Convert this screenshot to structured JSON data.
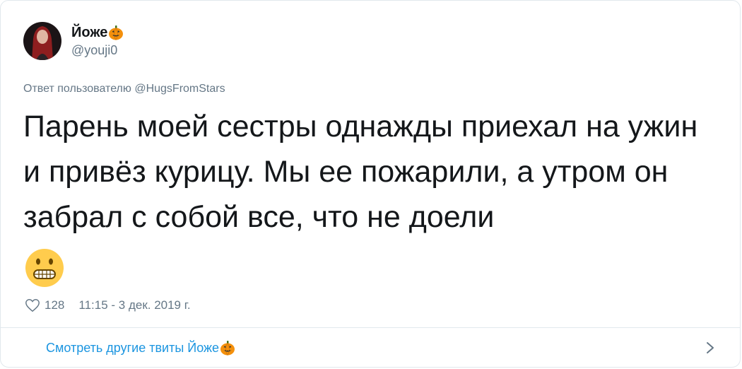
{
  "author": {
    "display_name": "Йоже",
    "name_emoji": "pumpkin-icon",
    "handle": "@youji0",
    "avatar": "avatar"
  },
  "reply_to": "Ответ пользователю @HugsFromStars",
  "tweet": {
    "text": "Парень моей сестры однажды приехал на ужин и привёз курицу. Мы ее пожарили, а утром он забрал с собой все, что не доели",
    "emoji": "grimacing-face-icon"
  },
  "meta": {
    "likes": "128",
    "timestamp": "11:15 - 3 дек. 2019 г."
  },
  "footer": {
    "more_tweets": "Смотреть другие твиты Йоже"
  },
  "colors": {
    "text": "#14171a",
    "secondary": "#657786",
    "link": "#1b95e0",
    "border": "#e1e8ed"
  }
}
